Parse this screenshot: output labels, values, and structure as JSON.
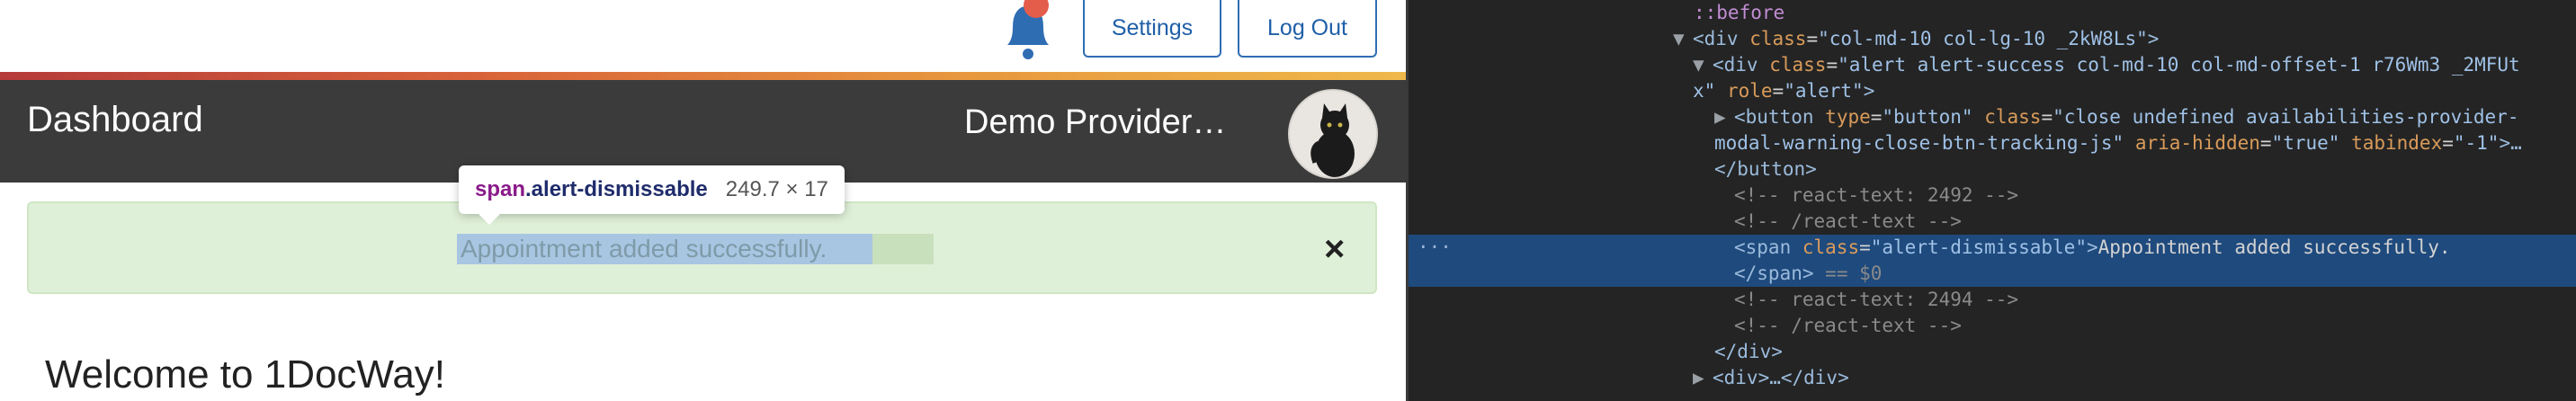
{
  "topbar": {
    "settings_label": "Settings",
    "logout_label": "Log Out"
  },
  "navbar": {
    "title": "Dashboard",
    "user_name": "Demo Provider…"
  },
  "alert": {
    "text": "Appointment added successfully.",
    "close_glyph": "×"
  },
  "tooltip": {
    "tag": "span",
    "class_name": ".alert-dismissable",
    "size": "249.7 × 17"
  },
  "main": {
    "welcome": "Welcome to 1DocWay!"
  },
  "devtools": {
    "before_label": "::before",
    "l1_tag_open": "<div",
    "l1_attr": "class",
    "l1_val": "\"col-md-10 col-lg-10 _2kW8Ls\"",
    "l2_attr": "class",
    "l2_val": "\"alert alert-success col-md-10 col-md-offset-1 r76Wm3 _2MFUt",
    "l3_cont": "x\"",
    "l3_attr": "role",
    "l3_val": "\"alert\"",
    "l4_attr1": "type",
    "l4_val1": "\"button\"",
    "l4_attr2": "class",
    "l4_val2": "\"close undefined availabilities-provider-",
    "l5_val": "modal-warning-close-btn-tracking-js\"",
    "l5_attr2": "aria-hidden",
    "l5_val2": "\"true\"",
    "l5_attr3": "tabindex",
    "l5_val3": "\"-1\"",
    "l7_comment": "<!-- react-text: 2492 -->",
    "l8_comment": "<!-- /react-text -->",
    "l9_attr": "class",
    "l9_val": "\"alert-dismissable\"",
    "l9_text": "Appointment added successfully.",
    "l10_ref": "== $0",
    "l11_comment": "<!-- react-text: 2494 -->",
    "l12_comment": "<!-- /react-text -->",
    "row_dots": "···"
  },
  "colors": {
    "navbar_bg": "#3b3b3b",
    "alert_bg": "#dff0d8",
    "button_border": "#2f6db3",
    "devtools_bg": "#242424",
    "selected_row": "#1f4a7d"
  }
}
